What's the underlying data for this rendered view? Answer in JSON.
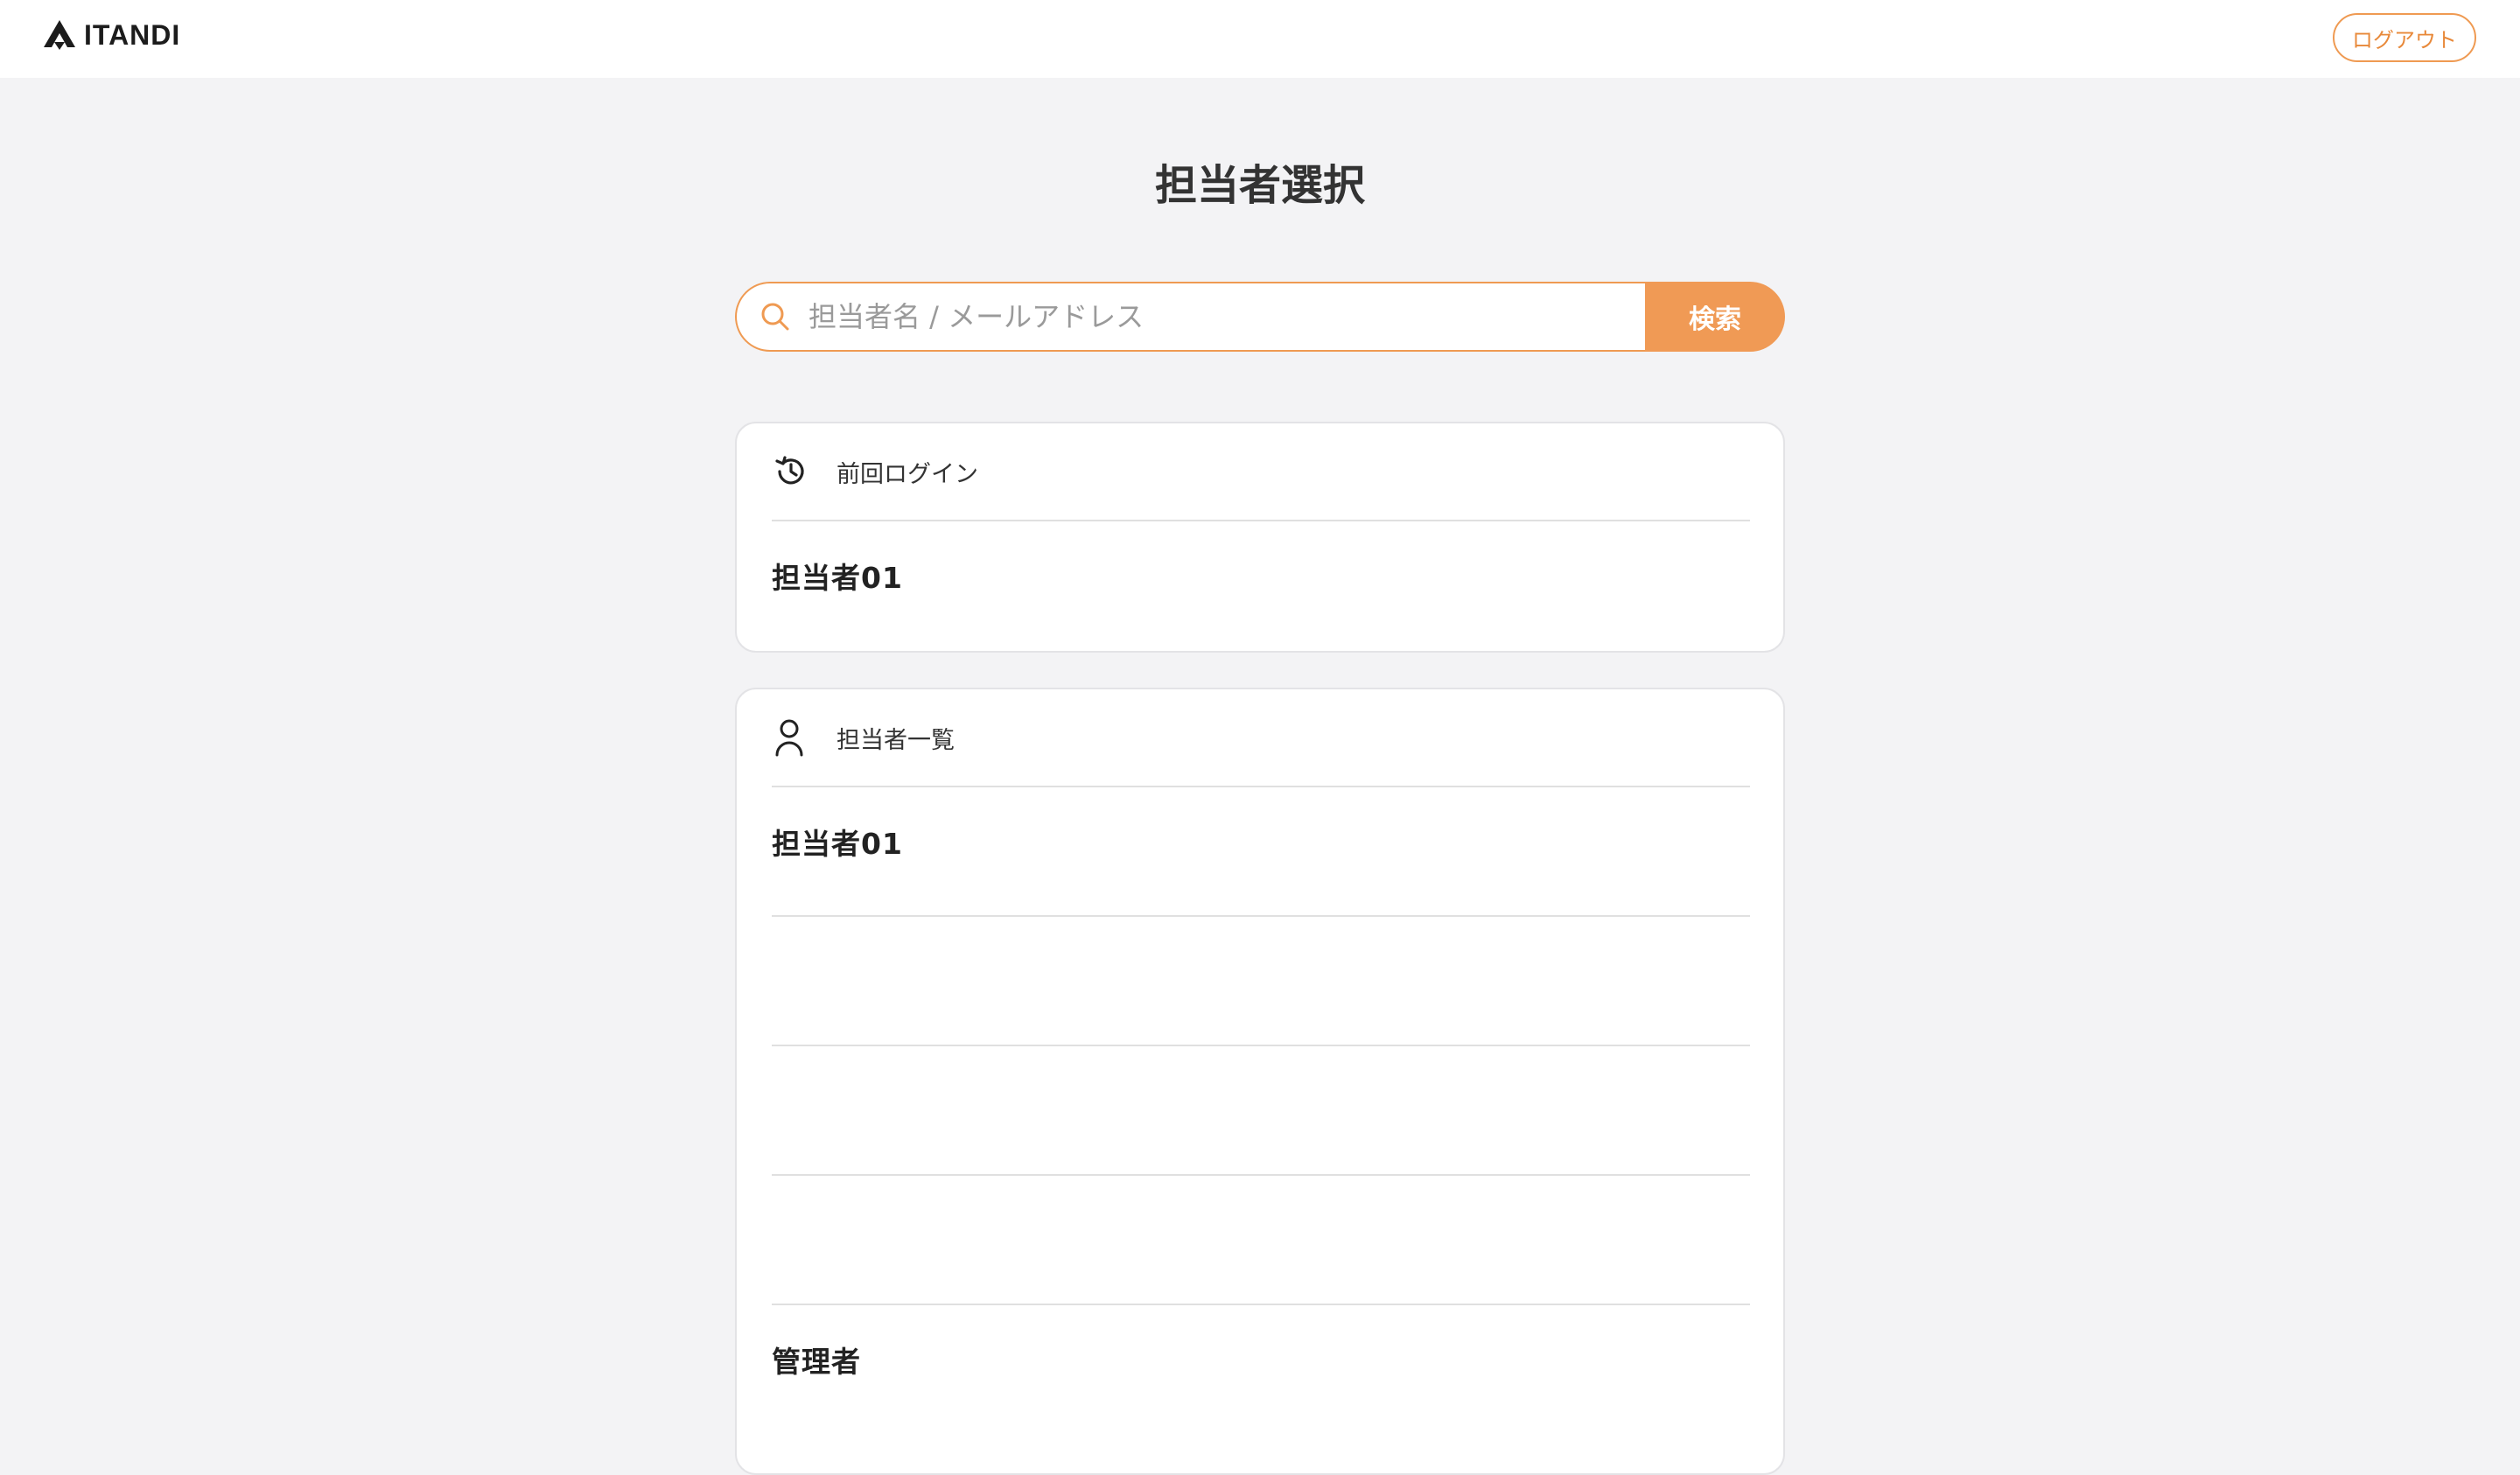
{
  "header": {
    "logo_text": "ITANDI",
    "logout_label": "ログアウト"
  },
  "main": {
    "title": "担当者選択",
    "search": {
      "placeholder": "担当者名 / メールアドレス",
      "value": "",
      "button_label": "検索"
    },
    "last_login": {
      "heading": "前回ログイン",
      "icon": "history-icon",
      "items": [
        {
          "name": "担当者01"
        }
      ]
    },
    "staff_list": {
      "heading": "担当者一覧",
      "icon": "user-icon",
      "items": [
        {
          "name": "担当者01"
        },
        {
          "name": ""
        },
        {
          "name": ""
        },
        {
          "name": ""
        },
        {
          "name": "管理者"
        }
      ]
    }
  },
  "colors": {
    "accent": "#f09a55",
    "background": "#f3f3f5"
  }
}
